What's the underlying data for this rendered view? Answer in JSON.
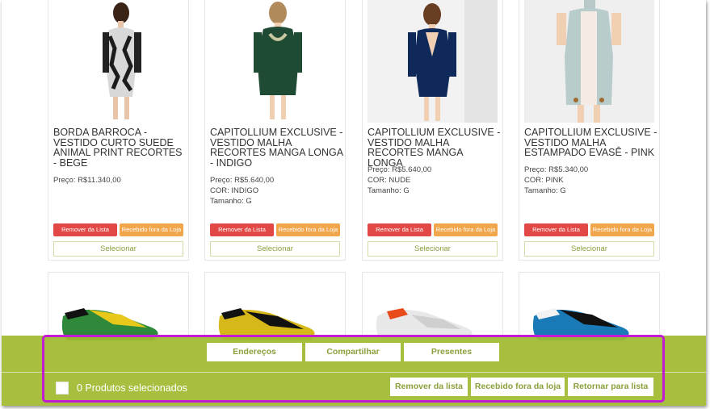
{
  "products": [
    {
      "title": "BORDA BARROCA - VESTIDO CURTO SUEDE ANIMAL PRINT RECORTES - BEGE",
      "price": "Preço: R$11.340,00",
      "color": "",
      "size": "",
      "remove_label": "Remover da Lista",
      "received_label": "Recebido fora da Loja",
      "select_label": "Selecionar"
    },
    {
      "title": "CAPITOLLIUM EXCLUSIVE - VESTIDO MALHA RECORTES MANGA LONGA - INDIGO",
      "price": "Preço: R$5.640,00",
      "color": "COR: INDIGO",
      "size": "Tamanho: G",
      "remove_label": "Remover da Lista",
      "received_label": "Recebido fora da Loja",
      "select_label": "Selecionar"
    },
    {
      "title": "CAPITOLLIUM EXCLUSIVE - VESTIDO MALHA RECORTES MANGA LONGA",
      "price": "Preço: R$5.640,00",
      "color": "COR: NUDE",
      "size": "Tamanho: G",
      "remove_label": "Remover da Lista",
      "received_label": "Recebido fora da Loja",
      "select_label": "Selecionar"
    },
    {
      "title": "CAPITOLLIUM EXCLUSIVE - VESTIDO MALHA ESTAMPADO EVASÊ - PINK",
      "price": "Preço: R$5.340,00",
      "color": "COR: PINK",
      "size": "Tamanho: G",
      "remove_label": "Remover da Lista",
      "received_label": "Recebido fora da Loja",
      "select_label": "Selecionar"
    }
  ],
  "bottom_bar": {
    "tabs": [
      "Endereços",
      "Compartilhar",
      "Presentes"
    ],
    "selected_count_text": "0 Produtos selecionados",
    "actions": [
      "Remover da lista",
      "Recebido fora da loja",
      "Retornar para lista"
    ]
  },
  "colors": {
    "accent_green": "#a0ba30",
    "remove_red": "#e24846",
    "received_orange": "#f2a64c",
    "highlight_magenta": "#c21bd3"
  },
  "icons": [
    "dress-image",
    "sneaker-image"
  ]
}
